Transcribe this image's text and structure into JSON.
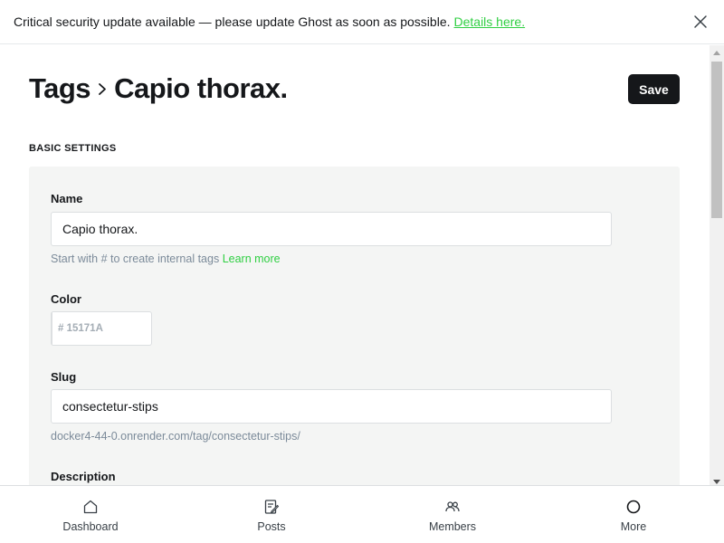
{
  "banner": {
    "message": "Critical security update available — please update Ghost as soon as possible.",
    "link_label": "Details here."
  },
  "header": {
    "breadcrumb_parent": "Tags",
    "breadcrumb_current": "Capio thorax.",
    "save_label": "Save"
  },
  "basic_settings": {
    "section_title": "BASIC SETTINGS",
    "name": {
      "label": "Name",
      "value": "Capio thorax.",
      "hint": "Start with # to create internal tags",
      "hint_link": "Learn more"
    },
    "color": {
      "label": "Color",
      "value": "# 15171A"
    },
    "slug": {
      "label": "Slug",
      "value": "consectetur-stips",
      "url_preview": "docker4-44-0.onrender.com/tag/consectetur-stips/"
    },
    "description": {
      "label": "Description"
    }
  },
  "bottom_nav": {
    "items": [
      {
        "label": "Dashboard",
        "icon": "home-icon"
      },
      {
        "label": "Posts",
        "icon": "posts-icon"
      },
      {
        "label": "Members",
        "icon": "members-icon"
      },
      {
        "label": "More",
        "icon": "more-icon"
      }
    ]
  },
  "colors": {
    "accent_green": "#30cf43",
    "primary_dark": "#15171a",
    "panel_bg": "#f4f5f4"
  }
}
